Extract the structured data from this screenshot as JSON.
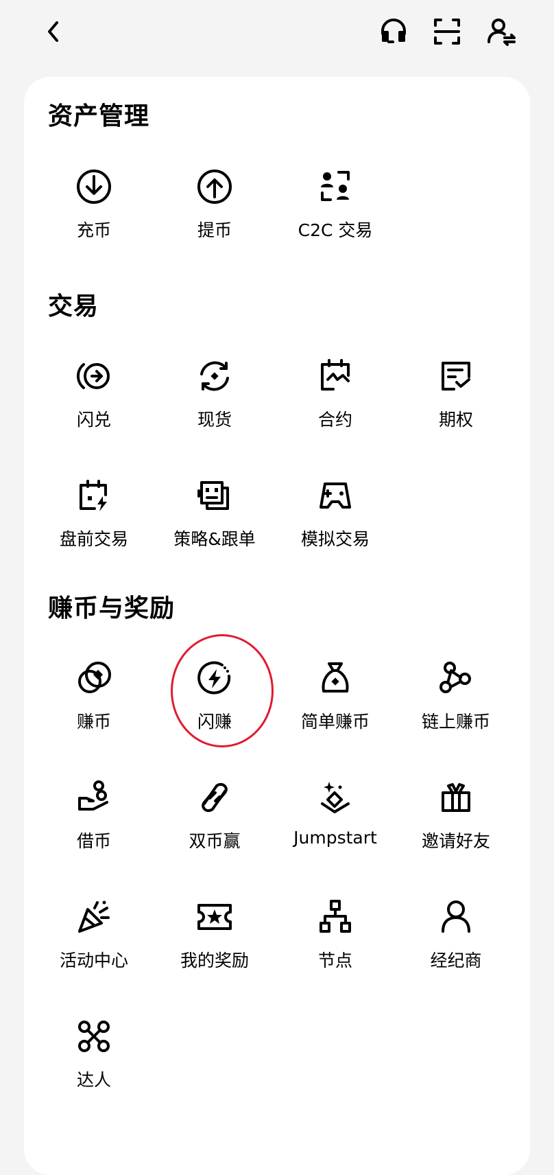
{
  "sections": [
    {
      "title": "资产管理",
      "items": [
        {
          "label": "充币",
          "icon": "deposit-icon"
        },
        {
          "label": "提币",
          "icon": "withdraw-icon"
        },
        {
          "label": "C2C 交易",
          "icon": "c2c-icon"
        }
      ]
    },
    {
      "title": "交易",
      "items": [
        {
          "label": "闪兑",
          "icon": "convert-icon"
        },
        {
          "label": "现货",
          "icon": "spot-icon"
        },
        {
          "label": "合约",
          "icon": "futures-icon"
        },
        {
          "label": "期权",
          "icon": "options-icon"
        },
        {
          "label": "盘前交易",
          "icon": "premarket-icon"
        },
        {
          "label": "策略&跟单",
          "icon": "bot-icon"
        },
        {
          "label": "模拟交易",
          "icon": "demo-trading-icon"
        }
      ]
    },
    {
      "title": "赚币与奖励",
      "items": [
        {
          "label": "赚币",
          "icon": "earn-icon"
        },
        {
          "label": "闪赚",
          "icon": "flash-earn-icon"
        },
        {
          "label": "简单赚币",
          "icon": "simple-earn-icon"
        },
        {
          "label": "链上赚币",
          "icon": "onchain-earn-icon"
        },
        {
          "label": "借币",
          "icon": "loan-icon"
        },
        {
          "label": "双币赢",
          "icon": "dual-investment-icon"
        },
        {
          "label": "Jumpstart",
          "icon": "jumpstart-icon"
        },
        {
          "label": "邀请好友",
          "icon": "gift-icon"
        },
        {
          "label": "活动中心",
          "icon": "party-popper-icon"
        },
        {
          "label": "我的奖励",
          "icon": "ticket-star-icon"
        },
        {
          "label": "节点",
          "icon": "node-tree-icon"
        },
        {
          "label": "经纪商",
          "icon": "person-icon"
        },
        {
          "label": "达人",
          "icon": "command-icon"
        }
      ]
    }
  ],
  "colors": {
    "highlight": "#e11b2e",
    "background": "#f4f4f4",
    "card": "#ffffff"
  }
}
